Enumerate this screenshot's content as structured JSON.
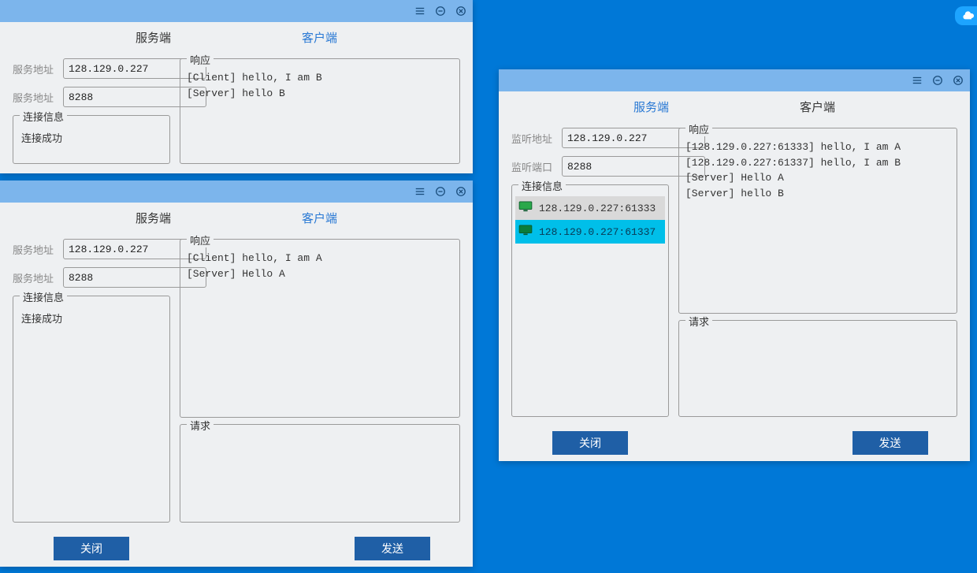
{
  "tabs": {
    "server": "服务端",
    "client": "客户端"
  },
  "labels": {
    "serviceAddress": "服务地址",
    "listenAddress": "监听地址",
    "listenPort": "监听端口",
    "connInfo": "连接信息",
    "response": "响应",
    "request": "请求"
  },
  "buttons": {
    "close": "关闭",
    "send": "发送"
  },
  "windowB": {
    "addr": "128.129.0.227",
    "port": "8288",
    "connStatus": "连接成功",
    "responseLog": "[Client] hello, I am B\n[Server] hello B"
  },
  "windowA": {
    "addr": "128.129.0.227",
    "port": "8288",
    "connStatus": "连接成功",
    "responseLog": "[Client] hello, I am A\n[Server] Hello A",
    "requestText": ""
  },
  "windowServer": {
    "addr": "128.129.0.227",
    "port": "8288",
    "connections": [
      {
        "label": "128.129.0.227:61333",
        "state": "normal"
      },
      {
        "label": "128.129.0.227:61337",
        "state": "selected"
      }
    ],
    "responseLog": "[128.129.0.227:61333] hello, I am A\n[128.129.0.227:61337] hello, I am B\n[Server] Hello A\n[Server] hello B",
    "requestText": ""
  }
}
